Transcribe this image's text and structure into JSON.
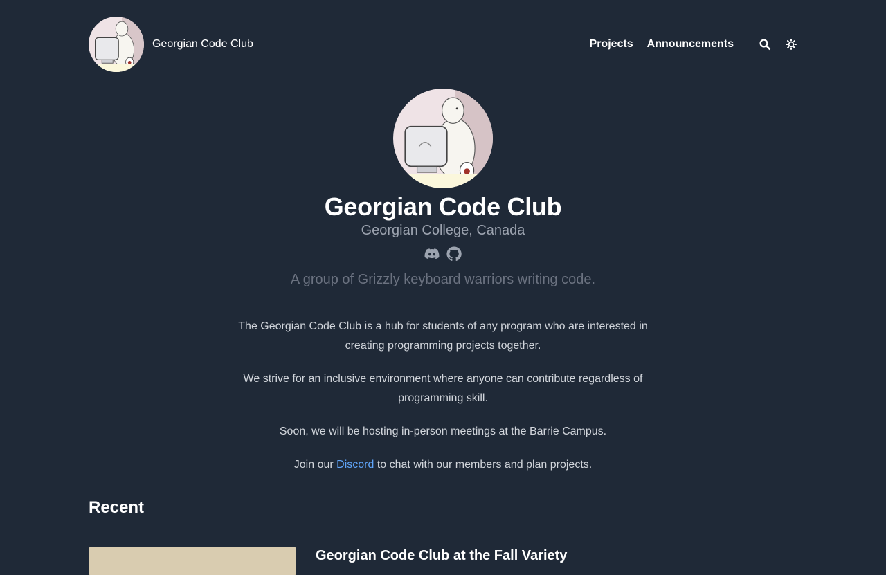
{
  "header": {
    "site_name": "Georgian Code Club",
    "logo_icon": "bear-at-computer-avatar",
    "nav": [
      {
        "label": "Projects"
      },
      {
        "label": "Announcements"
      }
    ],
    "search_icon": "search-icon",
    "theme_icon": "sun-icon"
  },
  "profile": {
    "title": "Georgian Code Club",
    "subtitle": "Georgian College, Canada",
    "social": [
      "discord-icon",
      "github-icon"
    ],
    "tagline": "A group of Grizzly keyboard warriors writing code."
  },
  "content": {
    "p1": "The Georgian Code Club is a hub for students of any program who are interested in creating programming projects together.",
    "p2": "We strive for an inclusive environment where anyone can contribute regardless of programming skill.",
    "p3": "Soon, we will be hosting in-person meetings at the Barrie Campus.",
    "p4_before": "Join our ",
    "p4_link": "Discord",
    "p4_after": " to chat with our members and plan projects."
  },
  "recent": {
    "heading": "Recent",
    "first_title": "Georgian Code Club at the Fall Variety"
  },
  "colors": {
    "background": "#1f2937",
    "link": "#60a5fa",
    "muted": "#9ca3af"
  }
}
